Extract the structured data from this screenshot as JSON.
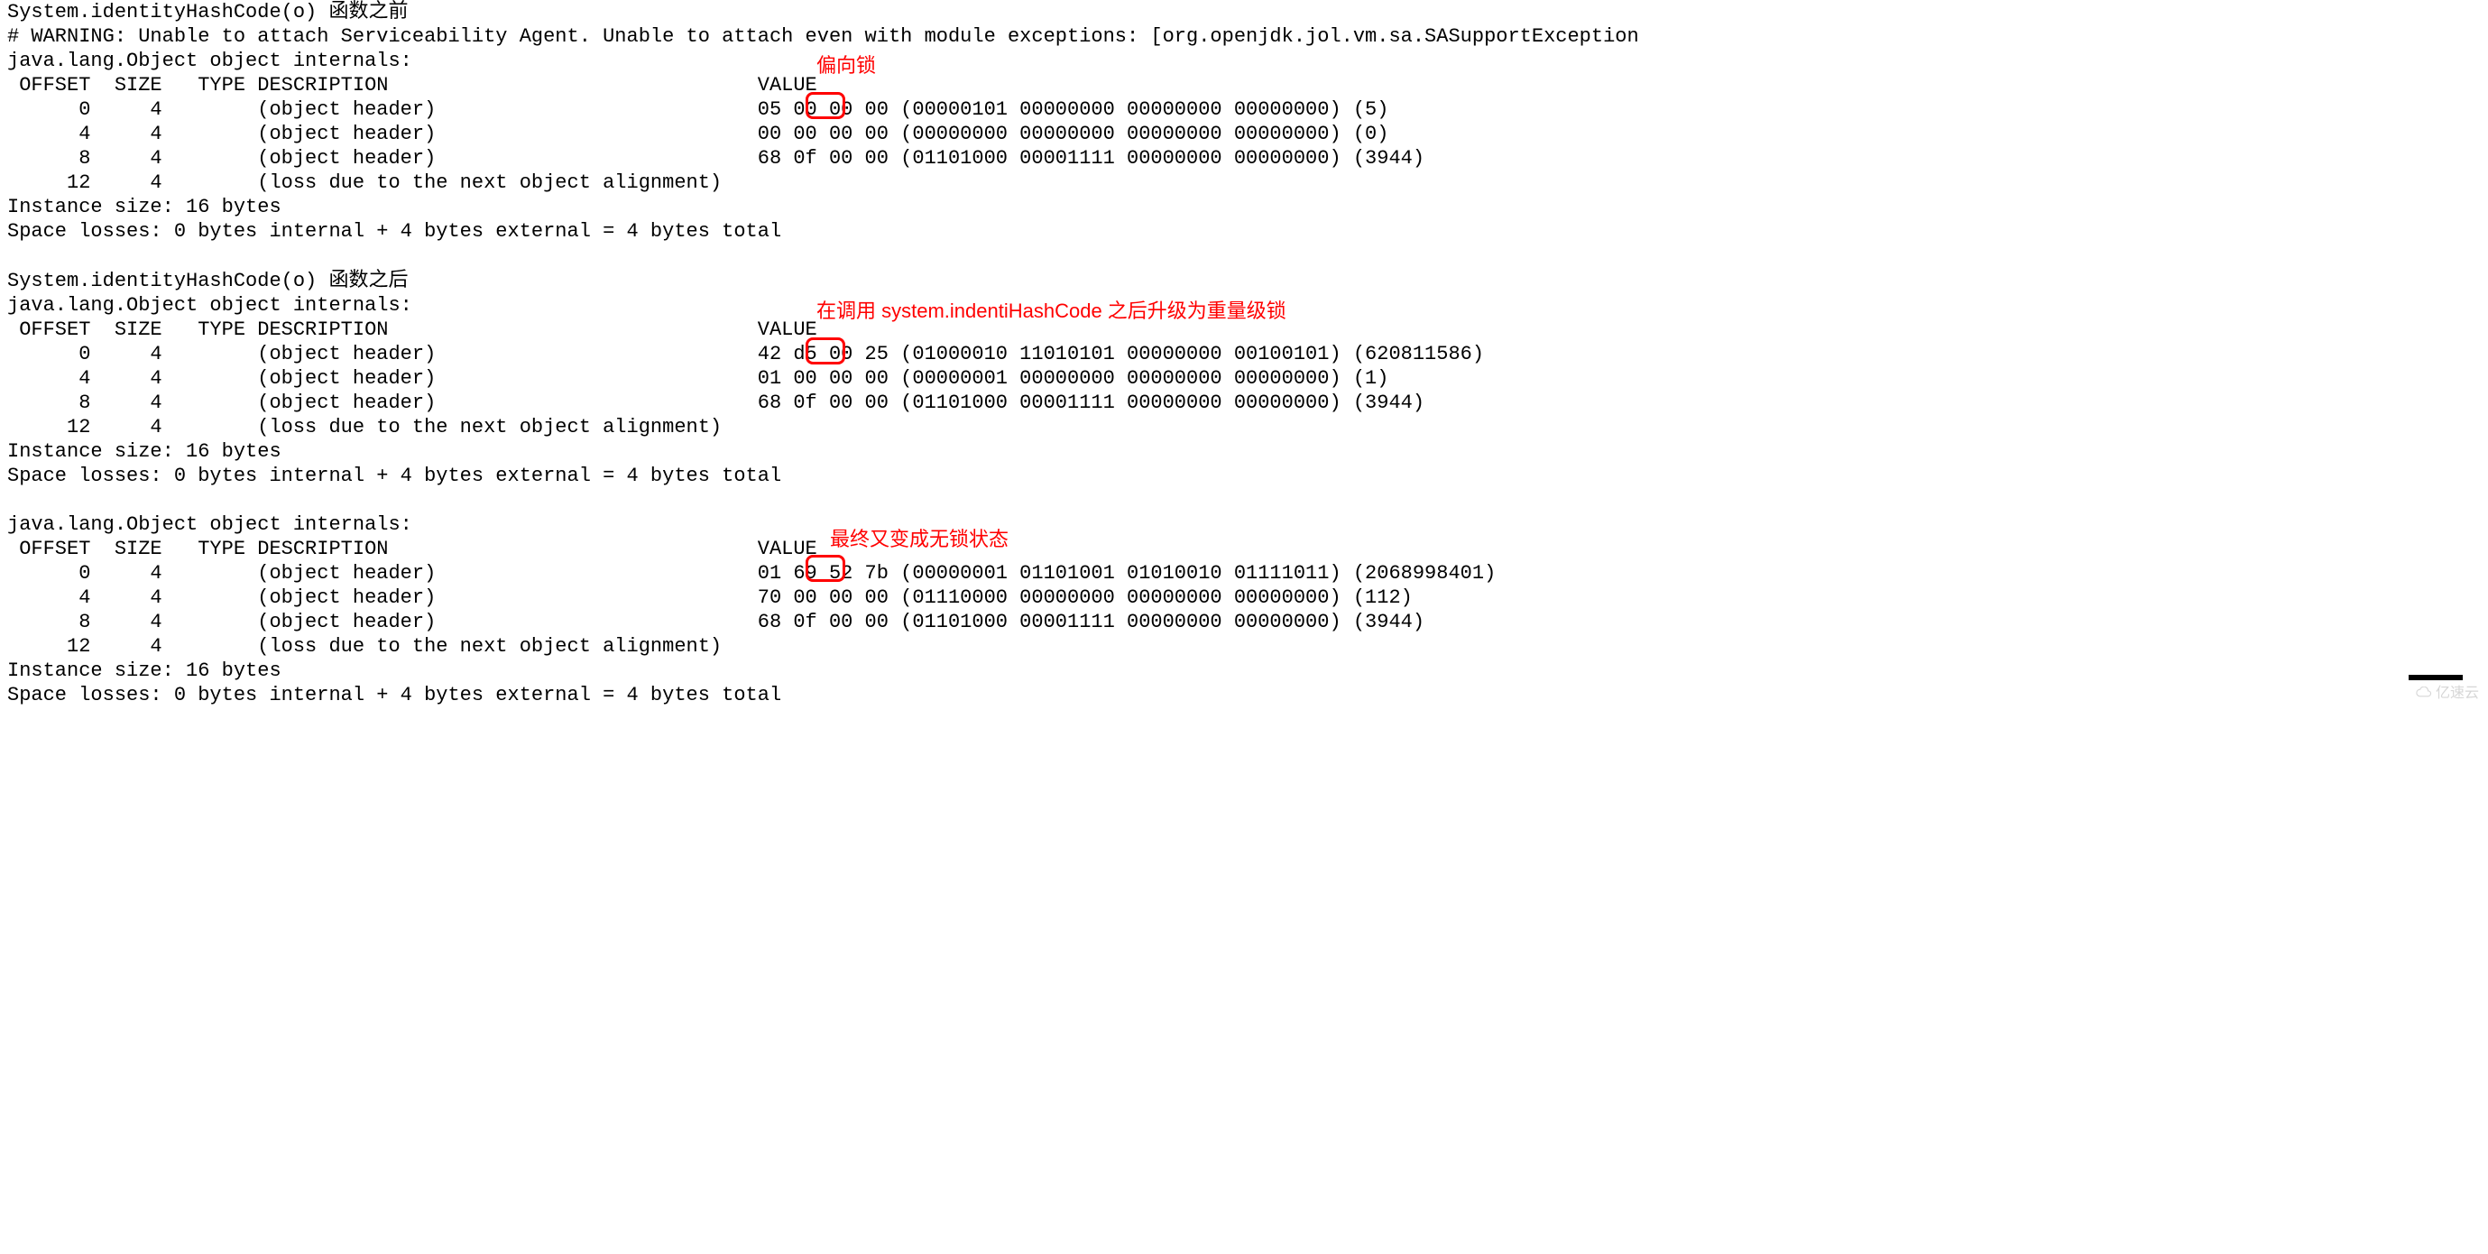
{
  "block1": {
    "title": "System.identityHashCode(o) 函数之前",
    "warning": "# WARNING: Unable to attach Serviceability Agent. Unable to attach even with module exceptions: [org.openjdk.jol.vm.sa.SASupportException",
    "internals": "java.lang.Object object internals:",
    "header": " OFFSET  SIZE   TYPE DESCRIPTION                               VALUE",
    "rows": [
      "      0     4        (object header)                           05 00 00 00 (00000101 00000000 00000000 00000000) (5)",
      "      4     4        (object header)                           00 00 00 00 (00000000 00000000 00000000 00000000) (0)",
      "      8     4        (object header)                           68 0f 00 00 (01101000 00001111 00000000 00000000) (3944)",
      "     12     4        (loss due to the next object alignment)"
    ],
    "size": "Instance size: 16 bytes",
    "losses": "Space losses: 0 bytes internal + 4 bytes external = 4 bytes total"
  },
  "block2": {
    "title": "System.identityHashCode(o) 函数之后",
    "internals": "java.lang.Object object internals:",
    "header": " OFFSET  SIZE   TYPE DESCRIPTION                               VALUE",
    "rows": [
      "      0     4        (object header)                           42 d5 00 25 (01000010 11010101 00000000 00100101) (620811586)",
      "      4     4        (object header)                           01 00 00 00 (00000001 00000000 00000000 00000000) (1)",
      "      8     4        (object header)                           68 0f 00 00 (01101000 00001111 00000000 00000000) (3944)",
      "     12     4        (loss due to the next object alignment)"
    ],
    "size": "Instance size: 16 bytes",
    "losses": "Space losses: 0 bytes internal + 4 bytes external = 4 bytes total"
  },
  "block3": {
    "internals": "java.lang.Object object internals:",
    "header": " OFFSET  SIZE   TYPE DESCRIPTION                               VALUE",
    "rows": [
      "      0     4        (object header)                           01 69 52 7b (00000001 01101001 01010010 01111011) (2068998401)",
      "      4     4        (object header)                           70 00 00 00 (01110000 00000000 00000000 00000000) (112)",
      "      8     4        (object header)                           68 0f 00 00 (01101000 00001111 00000000 00000000) (3944)",
      "     12     4        (loss due to the next object alignment)"
    ],
    "size": "Instance size: 16 bytes",
    "losses": "Space losses: 0 bytes internal + 4 bytes external = 4 bytes total"
  },
  "annotations": {
    "a1": "偏向锁",
    "a2": "在调用 system.indentiHashCode 之后升级为重量级锁",
    "a3": "最终又变成无锁状态"
  },
  "watermark": "亿速云"
}
